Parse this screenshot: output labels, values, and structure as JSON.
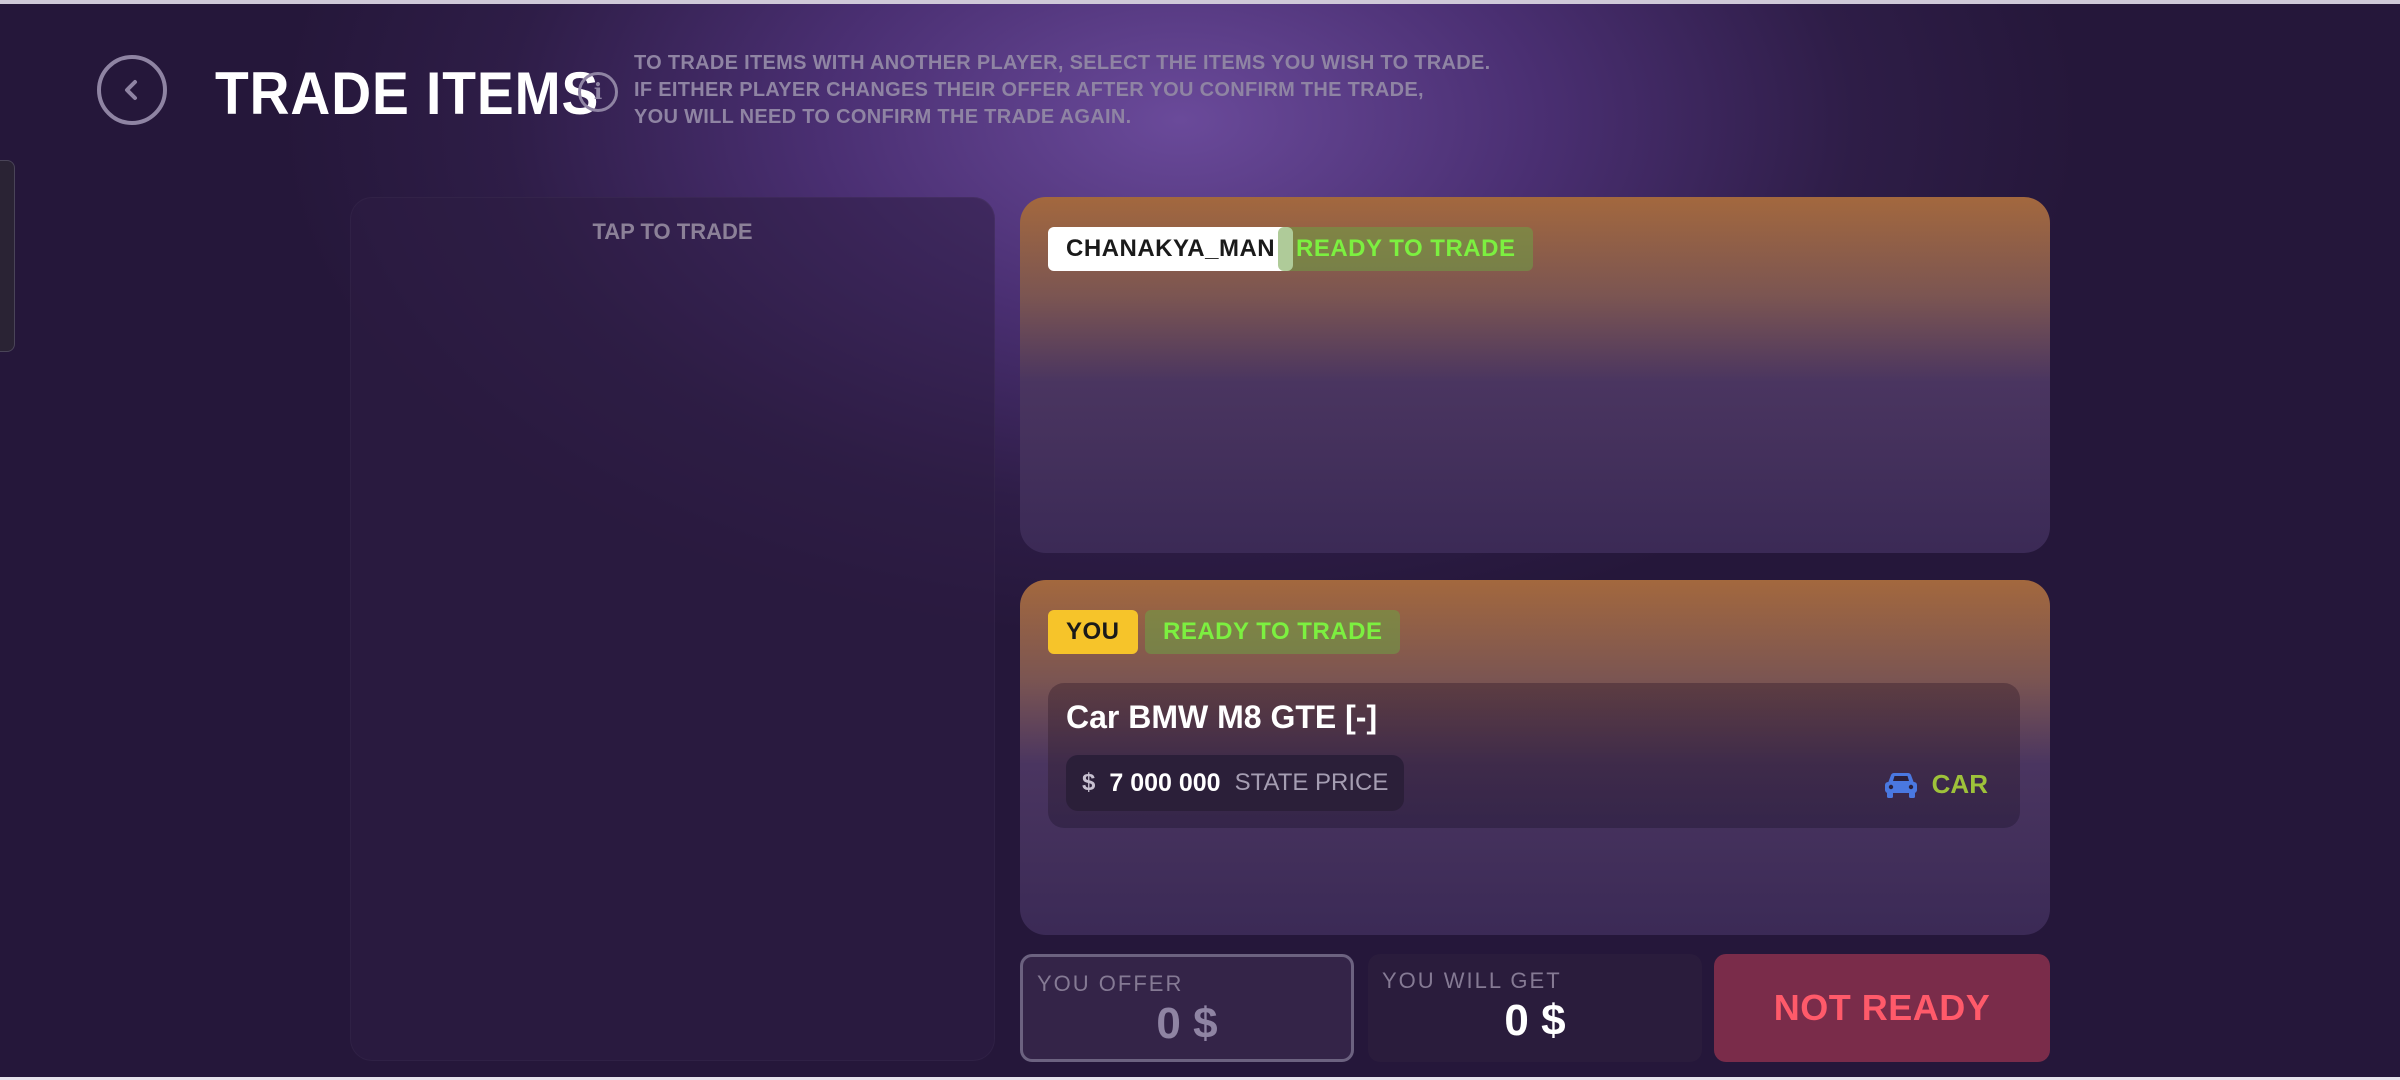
{
  "header": {
    "title": "TRADE ITEMS",
    "info_lines": [
      "TO TRADE ITEMS WITH ANOTHER PLAYER, SELECT THE ITEMS YOU WISH TO TRADE.",
      "IF EITHER PLAYER CHANGES THEIR OFFER AFTER YOU CONFIRM THE TRADE,",
      "YOU WILL NEED TO CONFIRM THE TRADE AGAIN."
    ]
  },
  "inventory": {
    "tap_label": "TAP TO TRADE"
  },
  "partner": {
    "name": "CHANAKYA_MAN",
    "status": "READY TO TRADE"
  },
  "you": {
    "label": "YOU",
    "status": "READY TO TRADE",
    "items": [
      {
        "name": "Car BMW M8 GTE [-]",
        "currency_symbol": "$",
        "price": "7 000 000",
        "price_label": "STATE PRICE",
        "type": "CAR",
        "icon": "car-icon"
      }
    ]
  },
  "summary": {
    "offer_label": "YOU OFFER",
    "offer_value": "0 $",
    "get_label": "YOU WILL GET",
    "get_value": "0 $",
    "action_label": "NOT READY"
  },
  "colors": {
    "ready_green": "#7cf040",
    "you_tag_yellow": "#f6c42a",
    "not_ready_red": "#ff5a6a",
    "car_type_green": "#9ec23a",
    "car_icon_blue": "#4a78e0"
  }
}
